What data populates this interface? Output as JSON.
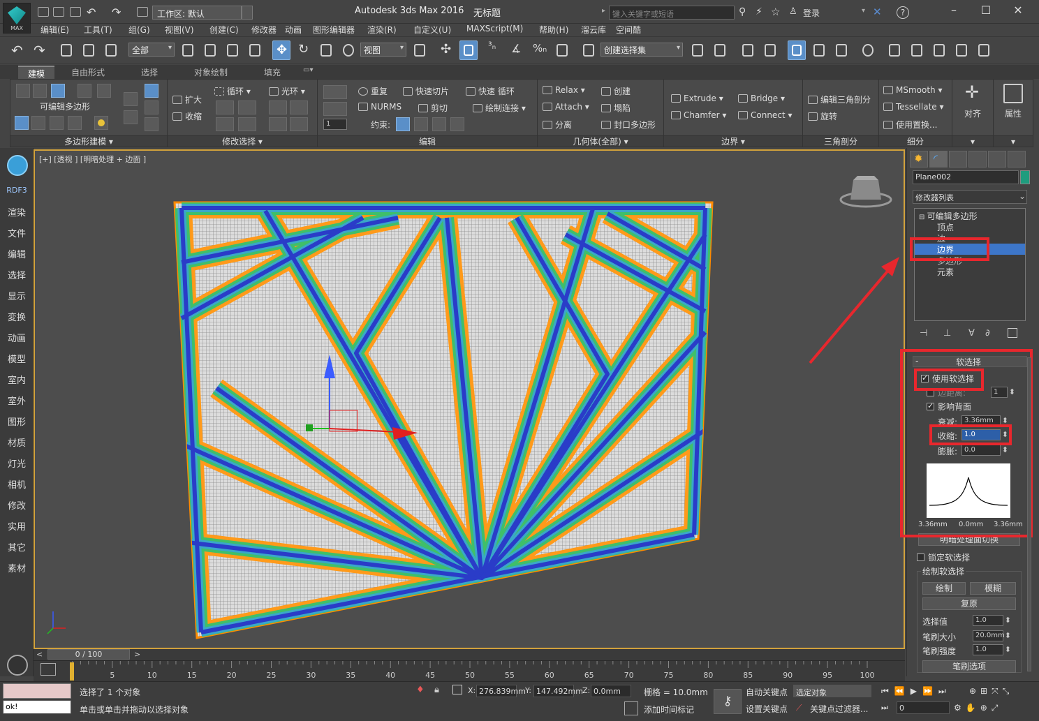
{
  "titlebar": {
    "app_logo_text": "MAX",
    "workspace": "工作区: 默认",
    "app_title": "Autodesk 3ds Max 2016",
    "doc_title": "无标题",
    "search_placeholder": "键入关键字或短语",
    "login": "登录",
    "help": "?"
  },
  "menu": [
    "编辑(E)",
    "工具(T)",
    "组(G)",
    "视图(V)",
    "创建(C)",
    "修改器",
    "动画",
    "图形编辑器",
    "渲染(R)",
    "自定义(U)",
    "MAXScript(M)",
    "帮助(H)",
    "溜云库",
    "空间酷"
  ],
  "toolbar": {
    "selection_filter": "全部",
    "ref_coord": "视图",
    "named_selection": "创建选择集"
  },
  "ribbon": {
    "tabs": [
      "建模",
      "自由形式",
      "选择",
      "对象绘制",
      "填充"
    ],
    "active_tab": "建模",
    "groups": {
      "poly_modeling": "多边形建模 ▾",
      "modify_selection": "修改选择 ▾",
      "edit": "编辑",
      "geometry": "几何体(全部) ▾",
      "border": "边界 ▾",
      "triangulation": "三角剖分",
      "subdivision": "细分"
    },
    "poly_label": "可编辑多边形",
    "mod_sel": {
      "grow": "扩大",
      "shrink": "收缩",
      "loop": "循环",
      "ring": "光环"
    },
    "edit": {
      "repeat": "重复",
      "quickslice": "快速切片",
      "swiftloop": "快速 循环",
      "nurms": "NURMS",
      "cut": "剪切",
      "paintconnect": "绘制连接",
      "constraints": "约束:",
      "stepper": "1"
    },
    "geometry": {
      "relax": "Relax",
      "create": "创建",
      "attach": "Attach",
      "collapse": "塌陷",
      "detach": "分离",
      "cap_poly": "封口多边形"
    },
    "border": {
      "extrude": "Extrude",
      "bridge": "Bridge",
      "chamfer": "Chamfer",
      "connect": "Connect"
    },
    "tri": {
      "edit_tri": "编辑三角剖分",
      "turn": "旋转"
    },
    "subdiv": {
      "msmooth": "MSmooth",
      "tessellate": "Tessellate",
      "use_displace": "使用置换..."
    },
    "align": "对齐",
    "props": "属性"
  },
  "leftbar": {
    "brand": "RDF3",
    "items": [
      "渲染",
      "文件",
      "编辑",
      "选择",
      "显示",
      "変换",
      "动画",
      "模型",
      "室内",
      "室外",
      "图形",
      "材质",
      "灯光",
      "相机",
      "修改",
      "实用",
      "其它",
      "素材"
    ]
  },
  "viewport": {
    "label": "[+] [透视 ] [明暗处理 + 边面 ]",
    "frame_counter": "0 / 100"
  },
  "cmdpanel": {
    "object_name": "Plane002",
    "modifier_list": "修改器列表",
    "stack": {
      "root": "可编辑多边形",
      "items": [
        "顶点",
        "边",
        "边界",
        "多边形",
        "元素"
      ],
      "selected": "边界"
    },
    "soft_selection": {
      "rollout": "软选择",
      "use_soft": "使用软选择",
      "edge_distance": "边距离:",
      "edge_distance_val": "1",
      "affect_backfacing": "影响背面",
      "falloff": "衰减:",
      "falloff_val": "3.36mm",
      "pinch": "收缩:",
      "pinch_val": "1.0",
      "bubble": "膨胀:",
      "bubble_val": "0.0",
      "curve_left": "3.36mm",
      "curve_mid": "0.0mm",
      "curve_right": "3.36mm",
      "shaded_face_toggle": "明暗处理面切换",
      "lock_soft": "锁定软选择",
      "paint_soft": "绘制软选择",
      "paint": "绘制",
      "blur": "模糊",
      "revert": "复原",
      "selection_value": "选择值",
      "selection_value_val": "1.0",
      "brush_size": "笔刷大小",
      "brush_size_val": "20.0mm",
      "brush_strength": "笔刷强度",
      "brush_strength_val": "1.0",
      "brush_options": "笔刷选项"
    }
  },
  "timeline": {
    "ticks": [
      "5",
      "10",
      "15",
      "20",
      "25",
      "30",
      "35",
      "40",
      "45",
      "50",
      "55",
      "60",
      "65",
      "70",
      "75",
      "80",
      "85",
      "90",
      "95",
      "100"
    ]
  },
  "status": {
    "script_output": "ok!",
    "selected": "选择了 1 个对象",
    "prompt": "单击或单击并拖动以选择对象",
    "x_label": "X:",
    "x_val": "276.839mm",
    "y_label": "Y:",
    "y_val": "147.492mm",
    "z_label": "Z:",
    "z_val": "0.0mm",
    "grid": "栅格 = 10.0mm",
    "add_time_tag": "添加时间标记",
    "auto_key": "自动关键点",
    "set_key": "设置关键点",
    "key_filter_sel": "选定对象",
    "key_filters": "关键点过滤器...",
    "frame_val": "0"
  }
}
